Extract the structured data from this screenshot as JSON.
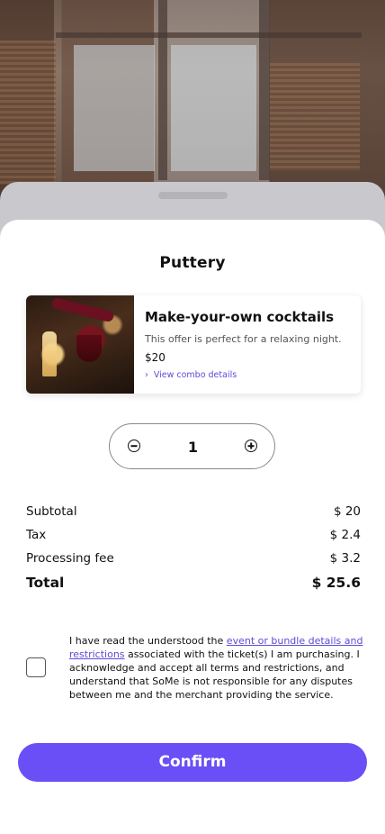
{
  "merchant": {
    "name": "Puttery"
  },
  "offer": {
    "title": "Make-your-own cocktails",
    "description": "This offer is perfect for a relaxing night.",
    "price": "$20",
    "details_link": "View combo details"
  },
  "quantity": {
    "value": "1"
  },
  "summary": {
    "subtotal_label": "Subtotal",
    "subtotal_value": "$ 20",
    "tax_label": "Tax",
    "tax_value": "$ 2.4",
    "fee_label": "Processing fee",
    "fee_value": "$ 3.2",
    "total_label": "Total",
    "total_value": "$ 25.6"
  },
  "terms": {
    "prefix": "I have read the understood the ",
    "link": "event or bundle details and restrictions",
    "suffix": " associated with the ticket(s) I am purchasing. I acknowledge and accept all terms and restrictions, and understand that SoMe is not responsible for any disputes between me and the merchant providing the service.",
    "checked": false
  },
  "actions": {
    "confirm_label": "Confirm"
  },
  "colors": {
    "accent": "#6b4ff6",
    "link": "#5b4bd6"
  }
}
